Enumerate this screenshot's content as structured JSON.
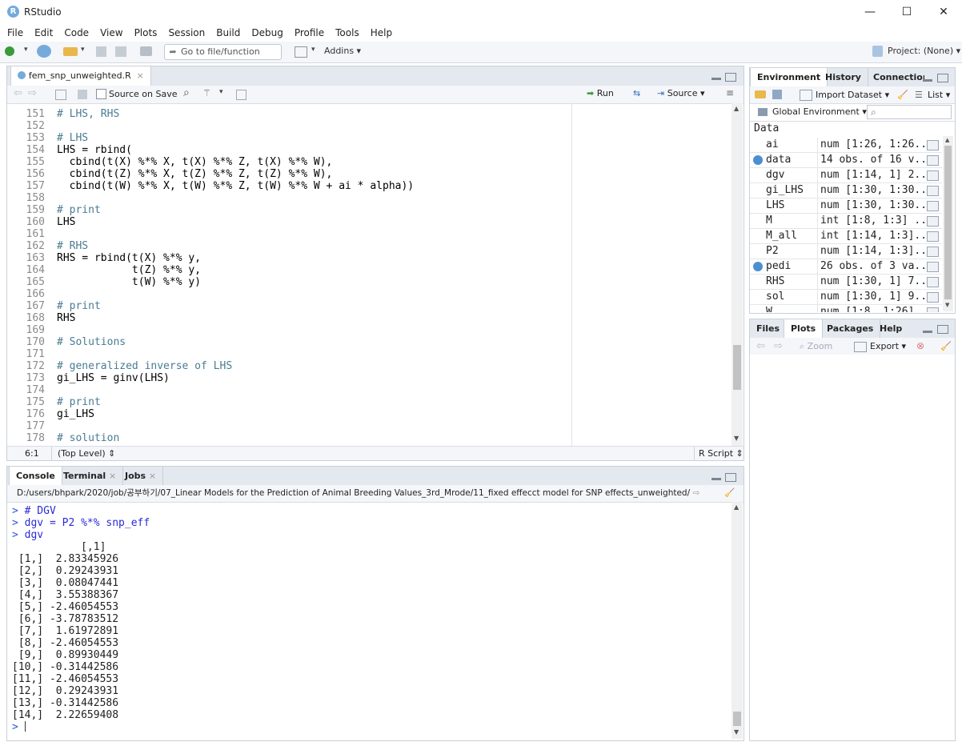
{
  "window": {
    "title": "RStudio",
    "minimize": "—",
    "maximize": "☐",
    "close": "✕"
  },
  "menu": [
    "File",
    "Edit",
    "Code",
    "View",
    "Plots",
    "Session",
    "Build",
    "Debug",
    "Profile",
    "Tools",
    "Help"
  ],
  "toolbar": {
    "goto_placeholder": "Go to file/function",
    "addins": "Addins",
    "project": "Project: (None)"
  },
  "editor": {
    "tab_label": "fem_snp_unweighted.R",
    "source_on_save": "Source on Save",
    "run": "Run",
    "source": "Source",
    "status_pos": "6:1",
    "status_scope": "(Top Level)",
    "status_type": "R Script",
    "lines": [
      {
        "n": "151",
        "t": "# LHS, RHS",
        "c": true
      },
      {
        "n": "152",
        "t": "",
        "c": false
      },
      {
        "n": "153",
        "t": "# LHS",
        "c": true
      },
      {
        "n": "154",
        "t": "LHS = rbind(",
        "c": false
      },
      {
        "n": "155",
        "t": "  cbind(t(X) %*% X, t(X) %*% Z, t(X) %*% W),",
        "c": false
      },
      {
        "n": "156",
        "t": "  cbind(t(Z) %*% X, t(Z) %*% Z, t(Z) %*% W),",
        "c": false
      },
      {
        "n": "157",
        "t": "  cbind(t(W) %*% X, t(W) %*% Z, t(W) %*% W + ai * alpha))",
        "c": false
      },
      {
        "n": "158",
        "t": "",
        "c": false
      },
      {
        "n": "159",
        "t": "# print",
        "c": true
      },
      {
        "n": "160",
        "t": "LHS",
        "c": false
      },
      {
        "n": "161",
        "t": "",
        "c": false
      },
      {
        "n": "162",
        "t": "# RHS",
        "c": true
      },
      {
        "n": "163",
        "t": "RHS = rbind(t(X) %*% y,",
        "c": false
      },
      {
        "n": "164",
        "t": "            t(Z) %*% y,",
        "c": false
      },
      {
        "n": "165",
        "t": "            t(W) %*% y)",
        "c": false
      },
      {
        "n": "166",
        "t": "",
        "c": false
      },
      {
        "n": "167",
        "t": "# print",
        "c": true
      },
      {
        "n": "168",
        "t": "RHS",
        "c": false
      },
      {
        "n": "169",
        "t": "",
        "c": false
      },
      {
        "n": "170",
        "t": "# Solutions",
        "c": true
      },
      {
        "n": "171",
        "t": "",
        "c": false
      },
      {
        "n": "172",
        "t": "# generalized inverse of LHS",
        "c": true
      },
      {
        "n": "173",
        "t": "gi_LHS = ginv(LHS)",
        "c": false
      },
      {
        "n": "174",
        "t": "",
        "c": false
      },
      {
        "n": "175",
        "t": "# print",
        "c": true
      },
      {
        "n": "176",
        "t": "gi_LHS",
        "c": false
      },
      {
        "n": "177",
        "t": "",
        "c": false
      },
      {
        "n": "178",
        "t": "# solution",
        "c": true
      }
    ]
  },
  "console": {
    "tabs": [
      "Console",
      "Terminal",
      "Jobs"
    ],
    "path": "D:/users/bhpark/2020/job/공부하기/07_Linear Models for the Prediction of Animal Breeding Values_3rd_Mrode/11_fixed effecct model for SNP effects_unweighted/",
    "commands": [
      "# DGV",
      "dgv = P2 %*% snp_eff",
      "dgv"
    ],
    "header": "           [,1]",
    "rows": [
      " [1,]  2.83345926",
      " [2,]  0.29243931",
      " [3,]  0.08047441",
      " [4,]  3.55388367",
      " [5,] -2.46054553",
      " [6,] -3.78783512",
      " [7,]  1.61972891",
      " [8,] -2.46054553",
      " [9,]  0.89930449",
      "[10,] -0.31442586",
      "[11,] -2.46054553",
      "[12,]  0.29243931",
      "[13,] -0.31442586",
      "[14,]  2.22659408"
    ],
    "prompt": ">"
  },
  "environment": {
    "tabs": [
      "Environment",
      "History",
      "Connection"
    ],
    "import_dataset": "Import Dataset",
    "list_view": "List",
    "scope": "Global Environment",
    "section": "Data",
    "items": [
      {
        "name": "ai",
        "value": "num [1:26, 1:26...",
        "expand": false
      },
      {
        "name": "data",
        "value": "14 obs. of 16 v...",
        "expand": true
      },
      {
        "name": "dgv",
        "value": "num [1:14, 1] 2...",
        "expand": false
      },
      {
        "name": "gi_LHS",
        "value": "num [1:30, 1:30...",
        "expand": false
      },
      {
        "name": "LHS",
        "value": "num [1:30, 1:30...",
        "expand": false
      },
      {
        "name": "M",
        "value": "int [1:8, 1:3] ...",
        "expand": false
      },
      {
        "name": "M_all",
        "value": "int [1:14, 1:3]...",
        "expand": false
      },
      {
        "name": "P2",
        "value": "num [1:14, 1:3]...",
        "expand": false
      },
      {
        "name": "pedi",
        "value": "26 obs. of 3 va...",
        "expand": true
      },
      {
        "name": "RHS",
        "value": "num [1:30, 1] 7...",
        "expand": false
      },
      {
        "name": "sol",
        "value": "num [1:30, 1] 9...",
        "expand": false
      },
      {
        "name": "W",
        "value": "num [1:8, 1:26]...",
        "expand": false
      }
    ]
  },
  "files": {
    "tabs": [
      "Files",
      "Plots",
      "Packages",
      "Help"
    ],
    "zoom": "Zoom",
    "export": "Export"
  }
}
